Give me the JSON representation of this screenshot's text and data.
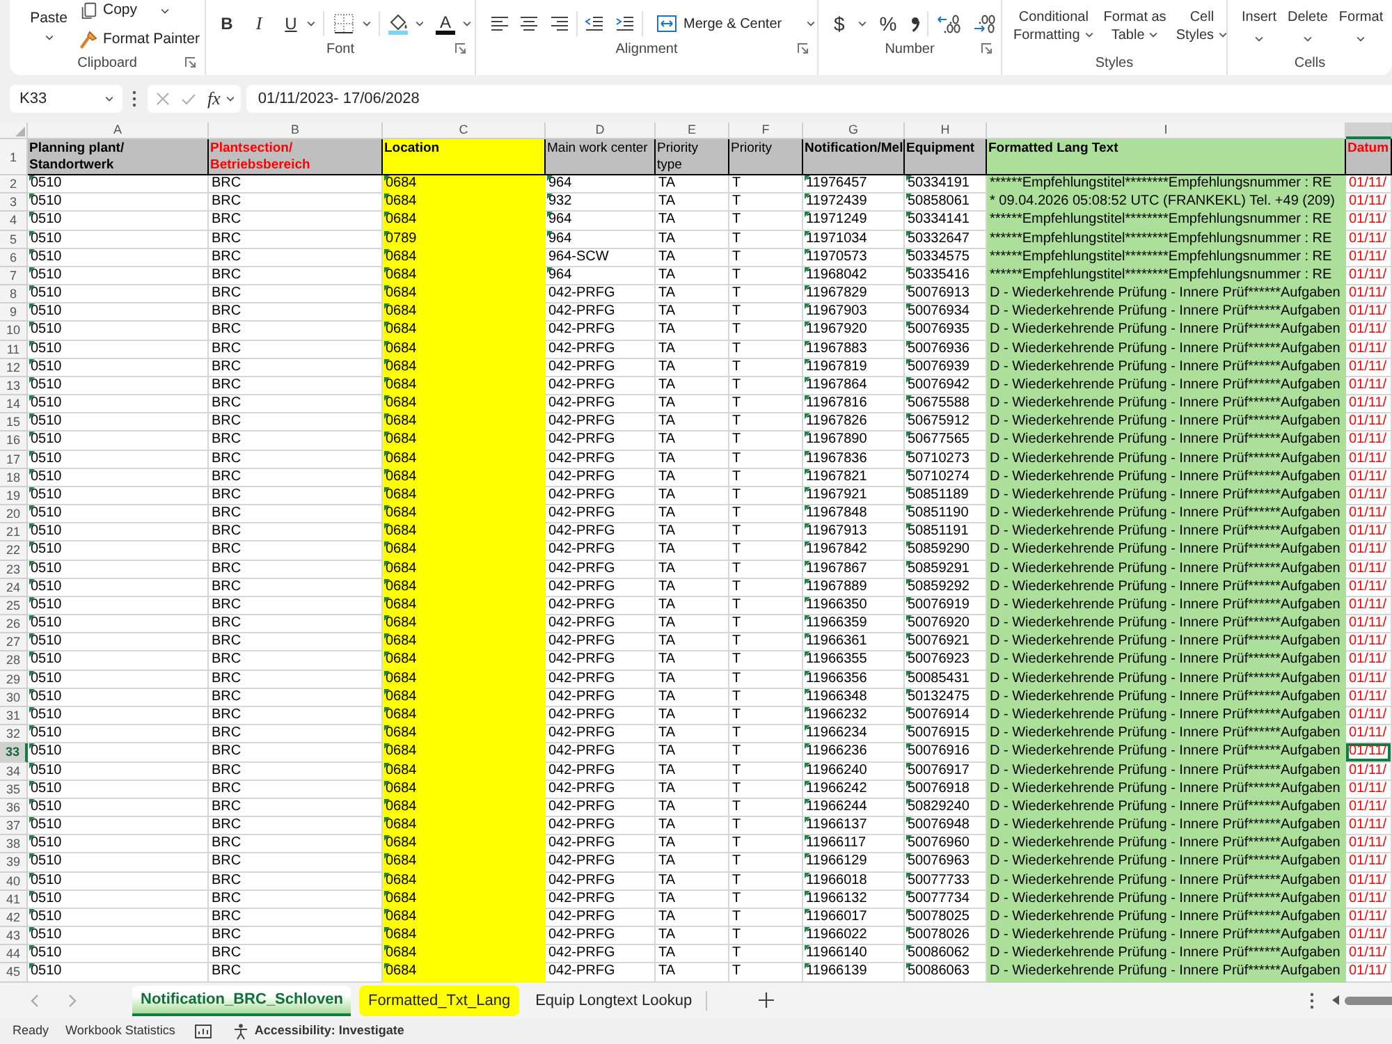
{
  "ribbon": {
    "groups": [
      {
        "label": "Clipboard",
        "launcher": true
      },
      {
        "label": "Font",
        "launcher": true
      },
      {
        "label": "Alignment",
        "launcher": true
      },
      {
        "label": "Number",
        "launcher": true
      },
      {
        "label": "Styles",
        "launcher": false
      },
      {
        "label": "Cells",
        "launcher": false
      }
    ],
    "clipboard": {
      "paste": "Paste",
      "copy": "Copy",
      "format_painter": "Format Painter"
    },
    "font": {
      "bold": "B",
      "italic": "I",
      "underline": "U",
      "font_color": "A"
    },
    "alignment": {
      "merge": "Merge & Center"
    },
    "number": {
      "currency": "$",
      "percent": "%"
    },
    "styles": [
      "Conditional\nFormatting",
      "Format as\nTable",
      "Cell\nStyles"
    ],
    "cells": [
      "Insert",
      "Delete",
      "Format"
    ]
  },
  "formula_bar": {
    "name_box": "K33",
    "function_button": "fx",
    "formula": "01/11/2023- 17/06/2028"
  },
  "sheet": {
    "heading_row_number": "1",
    "columns": [
      {
        "letter": "A",
        "heading": "Planning plant/\nStandortwerk",
        "bold": true,
        "kind": "plain",
        "color": "#000000",
        "flagged": true,
        "selected": false
      },
      {
        "letter": "B",
        "heading": "Plantsection/\nBetriebsbereich",
        "bold": true,
        "kind": "plain",
        "color": "#ff0000",
        "flagged": false,
        "selected": false
      },
      {
        "letter": "C",
        "heading": "Location",
        "bold": true,
        "kind": "yellow",
        "color": "#000000",
        "flagged": true,
        "selected": false
      },
      {
        "letter": "D",
        "heading": "Main work center",
        "bold": false,
        "kind": "plain",
        "color": "#000000",
        "flagged": false,
        "selected": false
      },
      {
        "letter": "E",
        "heading": "Priority\ntype",
        "bold": false,
        "kind": "plain",
        "color": "#000000",
        "flagged": false,
        "selected": false
      },
      {
        "letter": "F",
        "heading": "Priority",
        "bold": false,
        "kind": "plain",
        "color": "#000000",
        "flagged": false,
        "selected": false
      },
      {
        "letter": "G",
        "heading": "Notification/Mel",
        "bold": true,
        "kind": "plain",
        "color": "#000000",
        "flagged": true,
        "selected": false
      },
      {
        "letter": "H",
        "heading": "Equipment",
        "bold": true,
        "kind": "plain",
        "color": "#000000",
        "flagged": true,
        "selected": false
      },
      {
        "letter": "I",
        "heading": "Formatted Lang Text",
        "bold": true,
        "kind": "green",
        "color": "#000000",
        "flagged": false,
        "selected": false
      },
      {
        "heading": "Datum",
        "bold": true,
        "kind": "red",
        "color": "#ff0000",
        "flagged": false,
        "selected": true
      }
    ],
    "rows": [
      {
        "number": "2",
        "selected": false,
        "work_center_flagged": true,
        "cells": [
          "0510",
          "BRC",
          "0684",
          "964",
          "TA",
          "T",
          "11976457",
          "50334191",
          "******Empfehlungstitel********Empfehlungsnummer : RE",
          "01/11/"
        ]
      },
      {
        "number": "3",
        "selected": false,
        "work_center_flagged": true,
        "cells": [
          "0510",
          "BRC",
          "0684",
          "932",
          "TA",
          "T",
          "11972439",
          "50858061",
          "* 09.04.2026 05:08:52 UTC (FRANKEKL) Tel. +49 (209)",
          "01/11/"
        ]
      },
      {
        "number": "4",
        "selected": false,
        "work_center_flagged": true,
        "cells": [
          "0510",
          "BRC",
          "0684",
          "964",
          "TA",
          "T",
          "11971249",
          "50334141",
          "******Empfehlungstitel********Empfehlungsnummer : RE",
          "01/11/"
        ]
      },
      {
        "number": "5",
        "selected": false,
        "work_center_flagged": true,
        "cells": [
          "0510",
          "BRC",
          "0789",
          "964",
          "TA",
          "T",
          "11971034",
          "50332647",
          "******Empfehlungstitel********Empfehlungsnummer : RE",
          "01/11/"
        ]
      },
      {
        "number": "6",
        "selected": false,
        "work_center_flagged": false,
        "cells": [
          "0510",
          "BRC",
          "0684",
          "964-SCW",
          "TA",
          "T",
          "11970573",
          "50334575",
          "******Empfehlungstitel********Empfehlungsnummer : RE",
          "01/11/"
        ]
      },
      {
        "number": "7",
        "selected": false,
        "work_center_flagged": true,
        "cells": [
          "0510",
          "BRC",
          "0684",
          "964",
          "TA",
          "T",
          "11968042",
          "50335416",
          "******Empfehlungstitel********Empfehlungsnummer : RE",
          "01/11/"
        ]
      },
      {
        "number": "8",
        "selected": false,
        "work_center_flagged": false,
        "cells": [
          "0510",
          "BRC",
          "0684",
          "042-PRFG",
          "TA",
          "T",
          "11967829",
          "50076913",
          "D - Wiederkehrende Prüfung - Innere Prüf******Aufgaben",
          "01/11/"
        ]
      },
      {
        "number": "9",
        "selected": false,
        "work_center_flagged": false,
        "cells": [
          "0510",
          "BRC",
          "0684",
          "042-PRFG",
          "TA",
          "T",
          "11967903",
          "50076934",
          "D - Wiederkehrende Prüfung - Innere Prüf******Aufgaben",
          "01/11/"
        ]
      },
      {
        "number": "10",
        "selected": false,
        "work_center_flagged": false,
        "cells": [
          "0510",
          "BRC",
          "0684",
          "042-PRFG",
          "TA",
          "T",
          "11967920",
          "50076935",
          "D - Wiederkehrende Prüfung - Innere Prüf******Aufgaben",
          "01/11/"
        ]
      },
      {
        "number": "11",
        "selected": false,
        "work_center_flagged": false,
        "cells": [
          "0510",
          "BRC",
          "0684",
          "042-PRFG",
          "TA",
          "T",
          "11967883",
          "50076936",
          "D - Wiederkehrende Prüfung - Innere Prüf******Aufgaben",
          "01/11/"
        ]
      },
      {
        "number": "12",
        "selected": false,
        "work_center_flagged": false,
        "cells": [
          "0510",
          "BRC",
          "0684",
          "042-PRFG",
          "TA",
          "T",
          "11967819",
          "50076939",
          "D - Wiederkehrende Prüfung - Innere Prüf******Aufgaben",
          "01/11/"
        ]
      },
      {
        "number": "13",
        "selected": false,
        "work_center_flagged": false,
        "cells": [
          "0510",
          "BRC",
          "0684",
          "042-PRFG",
          "TA",
          "T",
          "11967864",
          "50076942",
          "D - Wiederkehrende Prüfung - Innere Prüf******Aufgaben",
          "01/11/"
        ]
      },
      {
        "number": "14",
        "selected": false,
        "work_center_flagged": false,
        "cells": [
          "0510",
          "BRC",
          "0684",
          "042-PRFG",
          "TA",
          "T",
          "11967816",
          "50675588",
          "D - Wiederkehrende Prüfung - Innere Prüf******Aufgaben",
          "01/11/"
        ]
      },
      {
        "number": "15",
        "selected": false,
        "work_center_flagged": false,
        "cells": [
          "0510",
          "BRC",
          "0684",
          "042-PRFG",
          "TA",
          "T",
          "11967826",
          "50675912",
          "D - Wiederkehrende Prüfung - Innere Prüf******Aufgaben",
          "01/11/"
        ]
      },
      {
        "number": "16",
        "selected": false,
        "work_center_flagged": false,
        "cells": [
          "0510",
          "BRC",
          "0684",
          "042-PRFG",
          "TA",
          "T",
          "11967890",
          "50677565",
          "D - Wiederkehrende Prüfung - Innere Prüf******Aufgaben",
          "01/11/"
        ]
      },
      {
        "number": "17",
        "selected": false,
        "work_center_flagged": false,
        "cells": [
          "0510",
          "BRC",
          "0684",
          "042-PRFG",
          "TA",
          "T",
          "11967836",
          "50710273",
          "D - Wiederkehrende Prüfung - Innere Prüf******Aufgaben",
          "01/11/"
        ]
      },
      {
        "number": "18",
        "selected": false,
        "work_center_flagged": false,
        "cells": [
          "0510",
          "BRC",
          "0684",
          "042-PRFG",
          "TA",
          "T",
          "11967821",
          "50710274",
          "D - Wiederkehrende Prüfung - Innere Prüf******Aufgaben",
          "01/11/"
        ]
      },
      {
        "number": "19",
        "selected": false,
        "work_center_flagged": false,
        "cells": [
          "0510",
          "BRC",
          "0684",
          "042-PRFG",
          "TA",
          "T",
          "11967921",
          "50851189",
          "D - Wiederkehrende Prüfung - Innere Prüf******Aufgaben",
          "01/11/"
        ]
      },
      {
        "number": "20",
        "selected": false,
        "work_center_flagged": false,
        "cells": [
          "0510",
          "BRC",
          "0684",
          "042-PRFG",
          "TA",
          "T",
          "11967848",
          "50851190",
          "D - Wiederkehrende Prüfung - Innere Prüf******Aufgaben",
          "01/11/"
        ]
      },
      {
        "number": "21",
        "selected": false,
        "work_center_flagged": false,
        "cells": [
          "0510",
          "BRC",
          "0684",
          "042-PRFG",
          "TA",
          "T",
          "11967913",
          "50851191",
          "D - Wiederkehrende Prüfung - Innere Prüf******Aufgaben",
          "01/11/"
        ]
      },
      {
        "number": "22",
        "selected": false,
        "work_center_flagged": false,
        "cells": [
          "0510",
          "BRC",
          "0684",
          "042-PRFG",
          "TA",
          "T",
          "11967842",
          "50859290",
          "D - Wiederkehrende Prüfung - Innere Prüf******Aufgaben",
          "01/11/"
        ]
      },
      {
        "number": "23",
        "selected": false,
        "work_center_flagged": false,
        "cells": [
          "0510",
          "BRC",
          "0684",
          "042-PRFG",
          "TA",
          "T",
          "11967867",
          "50859291",
          "D - Wiederkehrende Prüfung - Innere Prüf******Aufgaben",
          "01/11/"
        ]
      },
      {
        "number": "24",
        "selected": false,
        "work_center_flagged": false,
        "cells": [
          "0510",
          "BRC",
          "0684",
          "042-PRFG",
          "TA",
          "T",
          "11967889",
          "50859292",
          "D - Wiederkehrende Prüfung - Innere Prüf******Aufgaben",
          "01/11/"
        ]
      },
      {
        "number": "25",
        "selected": false,
        "work_center_flagged": false,
        "cells": [
          "0510",
          "BRC",
          "0684",
          "042-PRFG",
          "TA",
          "T",
          "11966350",
          "50076919",
          "D - Wiederkehrende Prüfung - Innere Prüf******Aufgaben",
          "01/11/"
        ]
      },
      {
        "number": "26",
        "selected": false,
        "work_center_flagged": false,
        "cells": [
          "0510",
          "BRC",
          "0684",
          "042-PRFG",
          "TA",
          "T",
          "11966359",
          "50076920",
          "D - Wiederkehrende Prüfung - Innere Prüf******Aufgaben",
          "01/11/"
        ]
      },
      {
        "number": "27",
        "selected": false,
        "work_center_flagged": false,
        "cells": [
          "0510",
          "BRC",
          "0684",
          "042-PRFG",
          "TA",
          "T",
          "11966361",
          "50076921",
          "D - Wiederkehrende Prüfung - Innere Prüf******Aufgaben",
          "01/11/"
        ]
      },
      {
        "number": "28",
        "selected": false,
        "work_center_flagged": false,
        "cells": [
          "0510",
          "BRC",
          "0684",
          "042-PRFG",
          "TA",
          "T",
          "11966355",
          "50076923",
          "D - Wiederkehrende Prüfung - Innere Prüf******Aufgaben",
          "01/11/"
        ]
      },
      {
        "number": "29",
        "selected": false,
        "work_center_flagged": false,
        "cells": [
          "0510",
          "BRC",
          "0684",
          "042-PRFG",
          "TA",
          "T",
          "11966356",
          "50085431",
          "D - Wiederkehrende Prüfung - Innere Prüf******Aufgaben",
          "01/11/"
        ]
      },
      {
        "number": "30",
        "selected": false,
        "work_center_flagged": false,
        "cells": [
          "0510",
          "BRC",
          "0684",
          "042-PRFG",
          "TA",
          "T",
          "11966348",
          "50132475",
          "D - Wiederkehrende Prüfung - Innere Prüf******Aufgaben",
          "01/11/"
        ]
      },
      {
        "number": "31",
        "selected": false,
        "work_center_flagged": false,
        "cells": [
          "0510",
          "BRC",
          "0684",
          "042-PRFG",
          "TA",
          "T",
          "11966232",
          "50076914",
          "D - Wiederkehrende Prüfung - Innere Prüf******Aufgaben",
          "01/11/"
        ]
      },
      {
        "number": "32",
        "selected": false,
        "work_center_flagged": false,
        "cells": [
          "0510",
          "BRC",
          "0684",
          "042-PRFG",
          "TA",
          "T",
          "11966234",
          "50076915",
          "D - Wiederkehrende Prüfung - Innere Prüf******Aufgaben",
          "01/11/"
        ]
      },
      {
        "number": "33",
        "selected": true,
        "work_center_flagged": false,
        "cells": [
          "0510",
          "BRC",
          "0684",
          "042-PRFG",
          "TA",
          "T",
          "11966236",
          "50076916",
          "D - Wiederkehrende Prüfung - Innere Prüf******Aufgaben",
          "01/11/"
        ]
      },
      {
        "number": "34",
        "selected": false,
        "work_center_flagged": false,
        "cells": [
          "0510",
          "BRC",
          "0684",
          "042-PRFG",
          "TA",
          "T",
          "11966240",
          "50076917",
          "D - Wiederkehrende Prüfung - Innere Prüf******Aufgaben",
          "01/11/"
        ]
      },
      {
        "number": "35",
        "selected": false,
        "work_center_flagged": false,
        "cells": [
          "0510",
          "BRC",
          "0684",
          "042-PRFG",
          "TA",
          "T",
          "11966242",
          "50076918",
          "D - Wiederkehrende Prüfung - Innere Prüf******Aufgaben",
          "01/11/"
        ]
      },
      {
        "number": "36",
        "selected": false,
        "work_center_flagged": false,
        "cells": [
          "0510",
          "BRC",
          "0684",
          "042-PRFG",
          "TA",
          "T",
          "11966244",
          "50829240",
          "D - Wiederkehrende Prüfung - Innere Prüf******Aufgaben",
          "01/11/"
        ]
      },
      {
        "number": "37",
        "selected": false,
        "work_center_flagged": false,
        "cells": [
          "0510",
          "BRC",
          "0684",
          "042-PRFG",
          "TA",
          "T",
          "11966137",
          "50076948",
          "D - Wiederkehrende Prüfung - Innere Prüf******Aufgaben",
          "01/11/"
        ]
      },
      {
        "number": "38",
        "selected": false,
        "work_center_flagged": false,
        "cells": [
          "0510",
          "BRC",
          "0684",
          "042-PRFG",
          "TA",
          "T",
          "11966117",
          "50076960",
          "D - Wiederkehrende Prüfung - Innere Prüf******Aufgaben",
          "01/11/"
        ]
      },
      {
        "number": "39",
        "selected": false,
        "work_center_flagged": false,
        "cells": [
          "0510",
          "BRC",
          "0684",
          "042-PRFG",
          "TA",
          "T",
          "11966129",
          "50076963",
          "D - Wiederkehrende Prüfung - Innere Prüf******Aufgaben",
          "01/11/"
        ]
      },
      {
        "number": "40",
        "selected": false,
        "work_center_flagged": false,
        "cells": [
          "0510",
          "BRC",
          "0684",
          "042-PRFG",
          "TA",
          "T",
          "11966018",
          "50077733",
          "D - Wiederkehrende Prüfung - Innere Prüf******Aufgaben",
          "01/11/"
        ]
      },
      {
        "number": "41",
        "selected": false,
        "work_center_flagged": false,
        "cells": [
          "0510",
          "BRC",
          "0684",
          "042-PRFG",
          "TA",
          "T",
          "11966132",
          "50077734",
          "D - Wiederkehrende Prüfung - Innere Prüf******Aufgaben",
          "01/11/"
        ]
      },
      {
        "number": "42",
        "selected": false,
        "work_center_flagged": false,
        "cells": [
          "0510",
          "BRC",
          "0684",
          "042-PRFG",
          "TA",
          "T",
          "11966017",
          "50078025",
          "D - Wiederkehrende Prüfung - Innere Prüf******Aufgaben",
          "01/11/"
        ]
      },
      {
        "number": "43",
        "selected": false,
        "work_center_flagged": false,
        "cells": [
          "0510",
          "BRC",
          "0684",
          "042-PRFG",
          "TA",
          "T",
          "11966022",
          "50078026",
          "D - Wiederkehrende Prüfung - Innere Prüf******Aufgaben",
          "01/11/"
        ]
      },
      {
        "number": "44",
        "selected": false,
        "work_center_flagged": false,
        "cells": [
          "0510",
          "BRC",
          "0684",
          "042-PRFG",
          "TA",
          "T",
          "11966140",
          "50086062",
          "D - Wiederkehrende Prüfung - Innere Prüf******Aufgaben",
          "01/11/"
        ]
      },
      {
        "number": "45",
        "selected": false,
        "work_center_flagged": false,
        "cells": [
          "0510",
          "BRC",
          "0684",
          "042-PRFG",
          "TA",
          "T",
          "11966139",
          "50086063",
          "D - Wiederkehrende Prüfung - Innere Prüf******Aufgaben",
          "01/11/"
        ]
      }
    ]
  },
  "sheet_tabs": [
    {
      "label": "Notification_BRC_Schloven",
      "selected": true,
      "color": "#a9dc98"
    },
    {
      "label": "Formatted_Txt_Lang",
      "selected": false,
      "color": "#ffff00"
    },
    {
      "label": "Equip Longtext Lookup",
      "selected": false
    }
  ],
  "status_bar": {
    "ready": "Ready",
    "workbook_statistics": "Workbook Statistics",
    "accessibility": "Accessibility: Investigate"
  }
}
